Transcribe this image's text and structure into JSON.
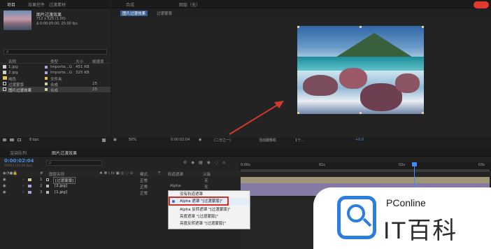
{
  "project": {
    "tabs": [
      "项目",
      "效果控件",
      "过渡素材"
    ],
    "comp_name": "图片过渡效果",
    "comp_info_1": "712 x 525 (1.00)",
    "comp_info_2": "Δ 0:00:05:00, 25.00 fps",
    "search_placeholder": "ρ",
    "columns": [
      "名称",
      "类型",
      "大小",
      "帧速率"
    ],
    "items": [
      {
        "name": "1.jpg",
        "type": "Importe...G",
        "size": "451 KB",
        "fps": "",
        "icon": "image-icon",
        "color": "#b0a0d8"
      },
      {
        "name": "2.jpg",
        "type": "Importe...G",
        "size": "325 KB",
        "fps": "",
        "icon": "image-icon",
        "color": "#b0a0d8"
      },
      {
        "name": "纯色",
        "type": "文件夹",
        "size": "",
        "fps": "",
        "icon": "folder-icon",
        "color": "#e2c15a"
      },
      {
        "name": "过渡蒙版",
        "type": "合成",
        "size": "",
        "fps": "25",
        "icon": "comp-icon",
        "color": "#d8cfa6"
      },
      {
        "name": "图片过渡效果",
        "type": "合成",
        "size": "",
        "fps": "25",
        "icon": "comp-icon",
        "color": "#d8cfa6"
      }
    ],
    "bpc": "8 bpc"
  },
  "viewer": {
    "tabs": [
      "合成",
      "图片过渡效果",
      "过渡蒙版"
    ],
    "layer_tab": "图层（无）",
    "zoom": "50%",
    "timecode": "0:00:02:04",
    "resolution": "(二分之一)",
    "camera": "活动摄像机",
    "views": "1个...",
    "exposure": "+0.0"
  },
  "timeline": {
    "tabs": [
      "渲染队列",
      "图片过渡效果"
    ],
    "current_time": "0:00:02:04",
    "time_sub": "00054 (25.00 fps)",
    "search_placeholder": "ρ",
    "col_headers": [
      "#",
      "图层名称",
      "模式",
      "T",
      "轨道遮罩",
      "父级"
    ],
    "layers": [
      {
        "num": "1",
        "name": "[过渡蒙版]",
        "mode": "正常",
        "track": "",
        "parent": "无",
        "color": "#d8cfa6"
      },
      {
        "num": "2",
        "name": "[2.jpg]",
        "mode": "正常",
        "track": "Alpha",
        "parent": "无",
        "color": "#b0a0d8"
      },
      {
        "num": "3",
        "name": "[1.jpg]",
        "mode": "正常",
        "track": "无",
        "parent": "无",
        "color": "#b0a0d8"
      }
    ],
    "ruler": [
      "0:00s",
      "01s",
      "02s",
      "03s"
    ]
  },
  "track_matte_menu": {
    "items": [
      "没有轨道遮罩",
      "Alpha 遮罩 \"[过渡蒙版]\"",
      "Alpha 反转遮罩 \"[过渡蒙版]\"",
      "亮度遮罩 \"[过渡蒙版]\"",
      "亮度反转遮罩 \"[过渡蒙版]\""
    ],
    "selected_index": 1
  },
  "watermark": {
    "brand": "PConline",
    "name": "IT百科"
  },
  "colors": {
    "accent": "#4f8de0",
    "highlight_box": "#d0302a",
    "arrow": "#d23a30",
    "playhead": "#3f8cff"
  }
}
